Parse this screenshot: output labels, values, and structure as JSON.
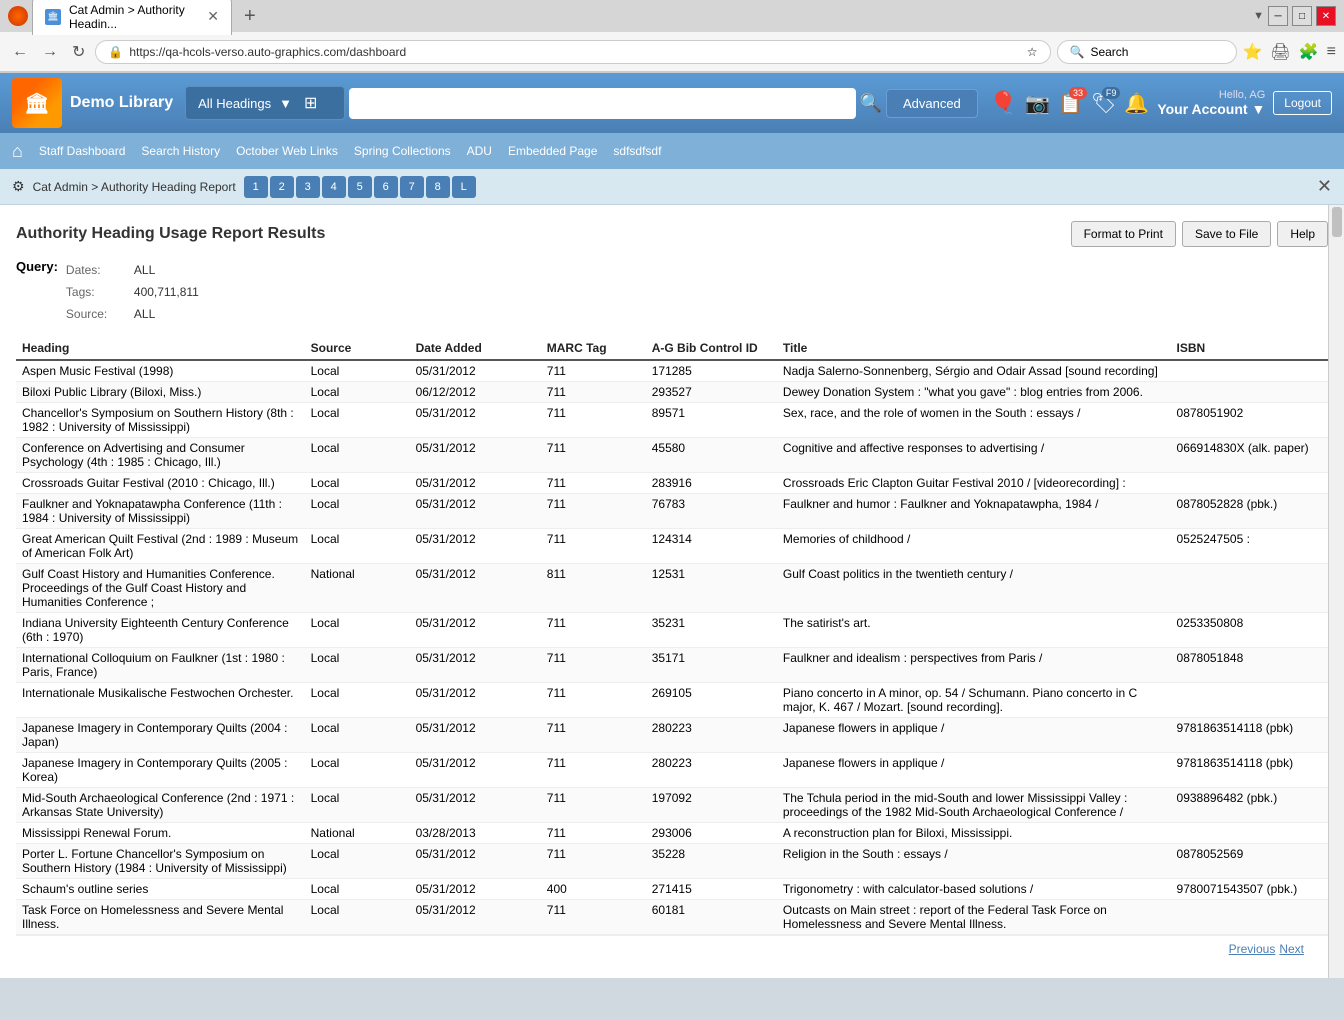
{
  "browser": {
    "tab_title": "Cat Admin > Authority Headin...",
    "url": "https://qa-hcols-verso.auto-graphics.com/dashboard",
    "search_placeholder": "Search"
  },
  "header": {
    "library_name": "Demo Library",
    "heading_select": "All Headings",
    "advanced_btn": "Advanced",
    "hello": "Hello, AG",
    "account": "Your Account",
    "logout": "Logout",
    "badge_33": "33",
    "badge_f9": "F9"
  },
  "nav": {
    "home_icon": "⌂",
    "links": [
      "Staff Dashboard",
      "Search History",
      "October Web Links",
      "Spring Collections",
      "ADU",
      "Embedded Page",
      "sdfsdfsdf"
    ]
  },
  "breadcrumb": {
    "path": "Cat Admin > Authority Heading Report",
    "tabs": [
      "1",
      "2",
      "3",
      "4",
      "5",
      "6",
      "7",
      "8",
      "L"
    ]
  },
  "report": {
    "title": "Authority Heading Usage Report Results",
    "format_btn": "Format to Print",
    "save_btn": "Save to File",
    "help_btn": "Help",
    "query_label": "Query:",
    "dates_label": "Dates:",
    "dates_value": "ALL",
    "tags_label": "Tags:",
    "tags_value": "400,711,811",
    "source_label": "Source:",
    "source_value": "ALL"
  },
  "table": {
    "columns": [
      "Heading",
      "Source",
      "Date Added",
      "MARC Tag",
      "A-G Bib Control ID",
      "Title",
      "ISBN"
    ],
    "rows": [
      {
        "heading": "Aspen Music Festival (1998)",
        "source": "Local",
        "date": "05/31/2012",
        "marc": "711",
        "ag_id": "171285",
        "title": "Nadja Salerno-Sonnenberg, Sérgio and Odair Assad [sound recording]",
        "isbn": ""
      },
      {
        "heading": "Biloxi Public Library (Biloxi, Miss.)",
        "source": "Local",
        "date": "06/12/2012",
        "marc": "711",
        "ag_id": "293527",
        "title": "Dewey Donation System : \"what you gave\" : blog entries from 2006.",
        "isbn": ""
      },
      {
        "heading": "Chancellor's Symposium on Southern History (8th : 1982 : University of Mississippi)",
        "source": "Local",
        "date": "05/31/2012",
        "marc": "711",
        "ag_id": "89571",
        "title": "Sex, race, and the role of women in the South : essays /",
        "isbn": "0878051902"
      },
      {
        "heading": "Conference on Advertising and Consumer Psychology (4th : 1985 : Chicago, Ill.)",
        "source": "Local",
        "date": "05/31/2012",
        "marc": "711",
        "ag_id": "45580",
        "title": "Cognitive and affective responses to advertising /",
        "isbn": "066914830X (alk. paper)"
      },
      {
        "heading": "Crossroads Guitar Festival (2010 : Chicago, Ill.)",
        "source": "Local",
        "date": "05/31/2012",
        "marc": "711",
        "ag_id": "283916",
        "title": "Crossroads Eric Clapton Guitar Festival 2010 / [videorecording] :",
        "isbn": ""
      },
      {
        "heading": "Faulkner and Yoknapatawpha Conference (11th : 1984 : University of Mississippi)",
        "source": "Local",
        "date": "05/31/2012",
        "marc": "711",
        "ag_id": "76783",
        "title": "Faulkner and humor : Faulkner and Yoknapatawpha, 1984 /",
        "isbn": "0878052828 (pbk.)"
      },
      {
        "heading": "Great American Quilt Festival (2nd : 1989 : Museum of American Folk Art)",
        "source": "Local",
        "date": "05/31/2012",
        "marc": "711",
        "ag_id": "124314",
        "title": "Memories of childhood /",
        "isbn": "0525247505 :"
      },
      {
        "heading": "Gulf Coast History and Humanities Conference. Proceedings of the Gulf Coast History and Humanities Conference ;",
        "source": "National",
        "date": "05/31/2012",
        "marc": "811",
        "ag_id": "12531",
        "title": "Gulf Coast politics in the twentieth century /",
        "isbn": ""
      },
      {
        "heading": "Indiana University Eighteenth Century Conference (6th : 1970)",
        "source": "Local",
        "date": "05/31/2012",
        "marc": "711",
        "ag_id": "35231",
        "title": "The satirist's art.",
        "isbn": "0253350808"
      },
      {
        "heading": "International Colloquium on Faulkner (1st : 1980 : Paris, France)",
        "source": "Local",
        "date": "05/31/2012",
        "marc": "711",
        "ag_id": "35171",
        "title": "Faulkner and idealism : perspectives from Paris /",
        "isbn": "0878051848"
      },
      {
        "heading": "Internationale Musikalische Festwochen Orchester.",
        "source": "Local",
        "date": "05/31/2012",
        "marc": "711",
        "ag_id": "269105",
        "title": "Piano concerto in A minor, op. 54 / Schumann. Piano concerto in C major, K. 467 / Mozart. [sound recording].",
        "isbn": ""
      },
      {
        "heading": "Japanese Imagery in Contemporary Quilts (2004 : Japan)",
        "source": "Local",
        "date": "05/31/2012",
        "marc": "711",
        "ag_id": "280223",
        "title": "Japanese flowers in applique /",
        "isbn": "9781863514118 (pbk)"
      },
      {
        "heading": "Japanese Imagery in Contemporary Quilts (2005 : Korea)",
        "source": "Local",
        "date": "05/31/2012",
        "marc": "711",
        "ag_id": "280223",
        "title": "Japanese flowers in applique /",
        "isbn": "9781863514118 (pbk)"
      },
      {
        "heading": "Mid-South Archaeological Conference (2nd : 1971 : Arkansas State University)",
        "source": "Local",
        "date": "05/31/2012",
        "marc": "711",
        "ag_id": "197092",
        "title": "The Tchula period in the mid-South and lower Mississippi Valley : proceedings of the 1982 Mid-South Archaeological Conference /",
        "isbn": "0938896482 (pbk.)"
      },
      {
        "heading": "Mississippi Renewal Forum.",
        "source": "National",
        "date": "03/28/2013",
        "marc": "711",
        "ag_id": "293006",
        "title": "A reconstruction plan for Biloxi, Mississippi.",
        "isbn": ""
      },
      {
        "heading": "Porter L. Fortune Chancellor's Symposium on Southern History (1984 : University of Mississippi)",
        "source": "Local",
        "date": "05/31/2012",
        "marc": "711",
        "ag_id": "35228",
        "title": "Religion in the South : essays /",
        "isbn": "0878052569"
      },
      {
        "heading": "Schaum's outline series",
        "source": "Local",
        "date": "05/31/2012",
        "marc": "400",
        "ag_id": "271415",
        "title": "Trigonometry : with calculator-based solutions /",
        "isbn": "9780071543507 (pbk.)"
      },
      {
        "heading": "Task Force on Homelessness and Severe Mental Illness.",
        "source": "Local",
        "date": "05/31/2012",
        "marc": "711",
        "ag_id": "60181",
        "title": "Outcasts on Main street : report of the Federal Task Force on Homelessness and Severe Mental Illness.",
        "isbn": ""
      }
    ]
  },
  "pagination": {
    "previous": "Previous",
    "next": "Next"
  }
}
